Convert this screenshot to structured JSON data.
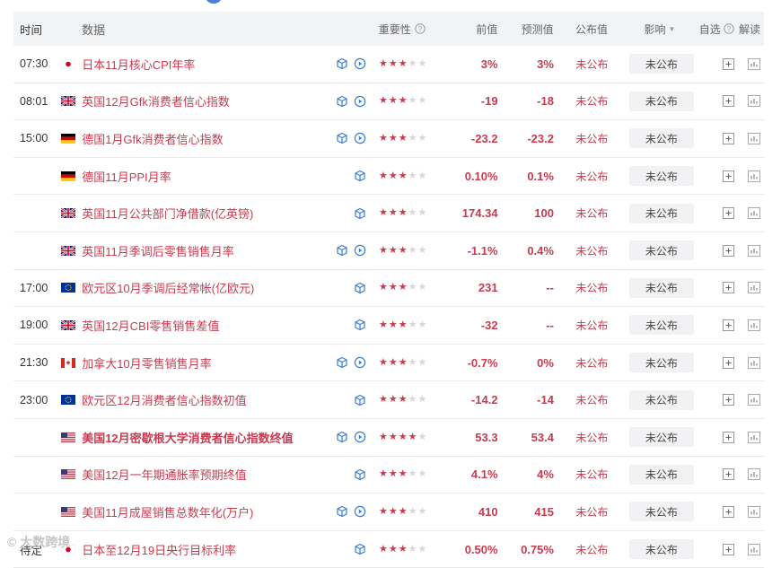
{
  "header": {
    "time": "时间",
    "data": "数据",
    "importance": "重要性",
    "previous": "前值",
    "forecast": "预测值",
    "actual": "公布值",
    "effect": "影响",
    "watch": "自选",
    "interpret": "解读"
  },
  "colors": {
    "accent": "#c83b4f",
    "star_off": "#d8d8d8",
    "icon_blue": "#3a7bd5"
  },
  "rows": [
    {
      "time": "07:30",
      "flag": "japan",
      "name": "日本11月核心CPI年率",
      "bold": false,
      "icons": [
        "cube-icon",
        "play-icon"
      ],
      "stars": 3,
      "previous": "3%",
      "forecast": "3%",
      "actual": "未公布",
      "effect": "未公布"
    },
    {
      "time": "08:01",
      "flag": "uk",
      "name": "英国12月Gfk消费者信心指数",
      "bold": false,
      "icons": [
        "cube-icon",
        "play-icon"
      ],
      "stars": 3,
      "previous": "-19",
      "forecast": "-18",
      "actual": "未公布",
      "effect": "未公布"
    },
    {
      "time": "15:00",
      "flag": "germany",
      "name": "德国1月Gfk消费者信心指数",
      "bold": false,
      "icons": [
        "cube-icon",
        "play-icon"
      ],
      "stars": 3,
      "previous": "-23.2",
      "forecast": "-23.2",
      "actual": "未公布",
      "effect": "未公布"
    },
    {
      "time": "",
      "flag": "germany",
      "name": "德国11月PPI月率",
      "bold": false,
      "icons": [
        "cube-icon"
      ],
      "stars": 3,
      "previous": "0.10%",
      "forecast": "0.1%",
      "actual": "未公布",
      "effect": "未公布"
    },
    {
      "time": "",
      "flag": "uk",
      "name": "英国11月公共部门净借款(亿英镑)",
      "bold": false,
      "icons": [
        "cube-icon"
      ],
      "stars": 3,
      "previous": "174.34",
      "forecast": "100",
      "actual": "未公布",
      "effect": "未公布"
    },
    {
      "time": "",
      "flag": "uk",
      "name": "英国11月季调后零售销售月率",
      "bold": false,
      "icons": [
        "cube-icon",
        "play-icon"
      ],
      "stars": 3,
      "previous": "-1.1%",
      "forecast": "0.4%",
      "actual": "未公布",
      "effect": "未公布"
    },
    {
      "time": "17:00",
      "flag": "eu",
      "name": "欧元区10月季调后经常帐(亿欧元)",
      "bold": false,
      "icons": [
        "cube-icon"
      ],
      "stars": 3,
      "previous": "231",
      "forecast": "--",
      "actual": "未公布",
      "effect": "未公布"
    },
    {
      "time": "19:00",
      "flag": "uk",
      "name": "英国12月CBI零售销售差值",
      "bold": false,
      "icons": [
        "cube-icon"
      ],
      "stars": 3,
      "previous": "-32",
      "forecast": "--",
      "actual": "未公布",
      "effect": "未公布"
    },
    {
      "time": "21:30",
      "flag": "canada",
      "name": "加拿大10月零售销售月率",
      "bold": false,
      "icons": [
        "cube-icon",
        "play-icon"
      ],
      "stars": 3,
      "previous": "-0.7%",
      "forecast": "0%",
      "actual": "未公布",
      "effect": "未公布"
    },
    {
      "time": "23:00",
      "flag": "eu",
      "name": "欧元区12月消费者信心指数初值",
      "bold": false,
      "icons": [
        "cube-icon"
      ],
      "stars": 3,
      "previous": "-14.2",
      "forecast": "-14",
      "actual": "未公布",
      "effect": "未公布"
    },
    {
      "time": "",
      "flag": "us",
      "name": "美国12月密歇根大学消费者信心指数终值",
      "bold": true,
      "icons": [
        "cube-icon",
        "play-icon"
      ],
      "stars": 4,
      "previous": "53.3",
      "forecast": "53.4",
      "actual": "未公布",
      "effect": "未公布"
    },
    {
      "time": "",
      "flag": "us",
      "name": "美国12月一年期通胀率预期终值",
      "bold": false,
      "icons": [
        "cube-icon"
      ],
      "stars": 3,
      "previous": "4.1%",
      "forecast": "4%",
      "actual": "未公布",
      "effect": "未公布"
    },
    {
      "time": "",
      "flag": "us",
      "name": "美国11月成屋销售总数年化(万户)",
      "bold": false,
      "icons": [
        "cube-icon",
        "play-icon"
      ],
      "stars": 3,
      "previous": "410",
      "forecast": "415",
      "actual": "未公布",
      "effect": "未公布"
    },
    {
      "time": "待定",
      "flag": "japan",
      "name": "日本至12月19日央行目标利率",
      "bold": false,
      "icons": [
        "cube-icon"
      ],
      "stars": 3,
      "previous": "0.50%",
      "forecast": "0.75%",
      "actual": "未公布",
      "effect": "未公布"
    }
  ],
  "watermark": "大数跨境"
}
